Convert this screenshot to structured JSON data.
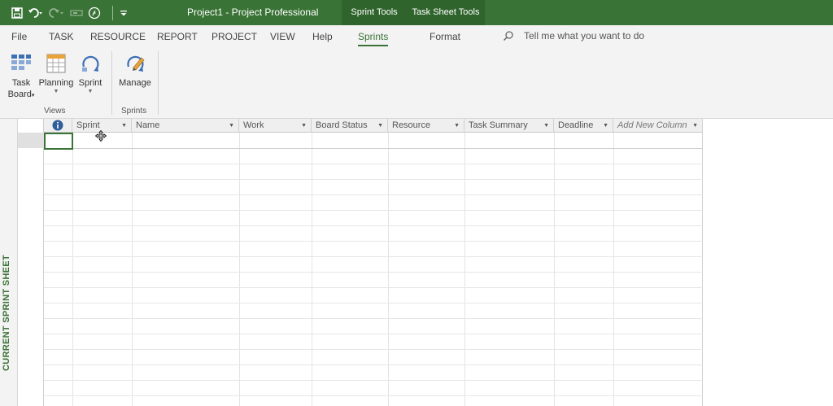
{
  "titlebar": {
    "title": "Project1  -  Project Professional",
    "context_tabs": [
      "Sprint Tools",
      "Task Sheet Tools"
    ],
    "bg": "#3a7336"
  },
  "ribbon_tabs": [
    "File",
    "TASK",
    "RESOURCE",
    "REPORT",
    "PROJECT",
    "VIEW",
    "Help",
    "Sprints",
    "Format"
  ],
  "active_tab": "Sprints",
  "tell_me": "Tell me what you want to do",
  "ribbon": {
    "buttons": {
      "task_board_line1": "Task",
      "task_board_line2": "Board",
      "planning": "Planning",
      "sprint": "Sprint",
      "manage": "Manage"
    },
    "groups": {
      "views": "Views",
      "sprints": "Sprints"
    }
  },
  "side_label": "CURRENT SPRINT SHEET",
  "columns": [
    "Sprint",
    "Name",
    "Work",
    "Board Status",
    "Resource",
    "Task Summary",
    "Deadline",
    "Add New Column"
  ],
  "icons": [
    "save-icon",
    "undo-icon",
    "redo-icon",
    "timeline-icon",
    "formula-icon",
    "customize-qat-icon",
    "search-icon",
    "task-board-icon",
    "planning-icon",
    "sprint-icon",
    "manage-icon",
    "info-icon",
    "move-cursor-icon"
  ]
}
